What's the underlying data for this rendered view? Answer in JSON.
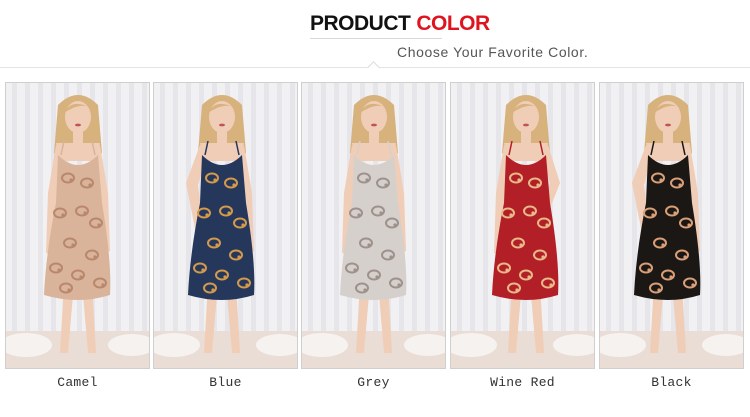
{
  "header": {
    "title_part1": "PRODUCT",
    "title_part2": "COLOR",
    "subtitle": "Choose Your Favorite Color."
  },
  "colors": {
    "title_dark": "#111111",
    "title_accent": "#e0141e",
    "subtitle": "#555555"
  },
  "products": [
    {
      "label": "Camel",
      "dress_color": "#d9b49a",
      "print_color": "#b9876c"
    },
    {
      "label": "Blue",
      "dress_color": "#26375c",
      "print_color": "#d39a4c"
    },
    {
      "label": "Grey",
      "dress_color": "#d6d0cc",
      "print_color": "#9e918c"
    },
    {
      "label": "Wine Red",
      "dress_color": "#b21f27",
      "print_color": "#e9b98a"
    },
    {
      "label": "Black",
      "dress_color": "#1b1715",
      "print_color": "#d9a078"
    }
  ]
}
